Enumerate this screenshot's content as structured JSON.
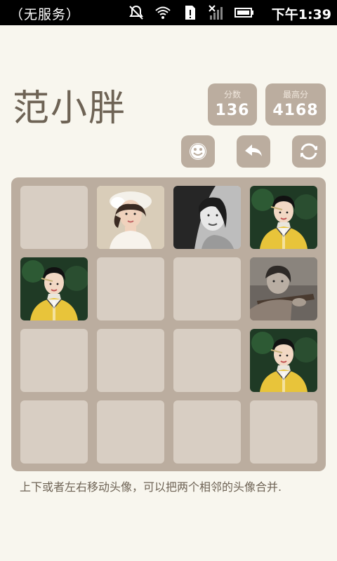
{
  "status_bar": {
    "carrier": "（无服务）",
    "time": "下午1:39",
    "icons": [
      "alarm-off-icon",
      "wifi-icon",
      "sd-card-alert-icon",
      "no-signal-icon",
      "battery-icon"
    ]
  },
  "app": {
    "title": "范小胖",
    "score": {
      "label": "分数",
      "value": "136"
    },
    "best": {
      "label": "最高分",
      "value": "4168"
    },
    "buttons": [
      "face-icon",
      "undo-icon",
      "restart-icon"
    ]
  },
  "board": {
    "rows": 4,
    "cols": 4,
    "tiles": [
      [
        "empty",
        "photo-woman-white-hat",
        "photo-woman-bw-portrait",
        "photo-woman-yellow-dress"
      ],
      [
        "photo-woman-yellow-dress",
        "empty",
        "empty",
        "photo-woman-sepia-rifle"
      ],
      [
        "empty",
        "empty",
        "empty",
        "photo-woman-yellow-dress"
      ],
      [
        "empty",
        "empty",
        "empty",
        "empty"
      ]
    ]
  },
  "colors": {
    "background": "#f8f6ee",
    "board": "#bbad9f",
    "empty_cell": "#d8cec3",
    "title_text": "#6e6355"
  },
  "hint": "上下或者左右移动头像，可以把两个相邻的头像合并."
}
